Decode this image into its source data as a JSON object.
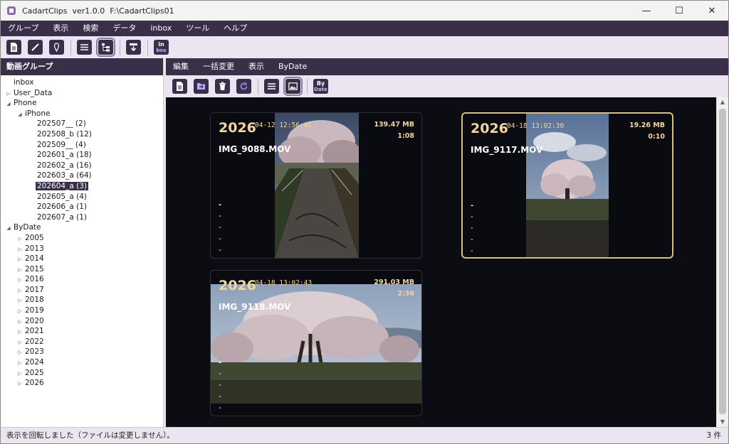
{
  "window": {
    "title": "CadartClips  ver1.0.0  F:\\CadartClips01",
    "minimize": "—",
    "maximize": "☐",
    "close": "✕"
  },
  "menu": [
    "グループ",
    "表示",
    "検索",
    "データ",
    "inbox",
    "ツール",
    "ヘルプ"
  ],
  "toolbar": {
    "inbox_label": "in",
    "inbox_sub": "box",
    "icons": [
      "document-icon",
      "pen-icon",
      "pin-icon",
      "list-icon",
      "tree-icon",
      "import-icon",
      "inbox-icon"
    ]
  },
  "left_panel": {
    "header": "動画グループ",
    "tree": [
      {
        "label": "inbox",
        "level": 0,
        "toggle": ""
      },
      {
        "label": "User_Data",
        "level": 0,
        "toggle": "▷"
      },
      {
        "label": "Phone",
        "level": 0,
        "toggle": "◢"
      },
      {
        "label": "iPhone",
        "level": 1,
        "toggle": "◢"
      },
      {
        "label": "202507__ (2)",
        "level": 2,
        "toggle": ""
      },
      {
        "label": "202508_b (12)",
        "level": 2,
        "toggle": ""
      },
      {
        "label": "202509__ (4)",
        "level": 2,
        "toggle": ""
      },
      {
        "label": "202601_a (18)",
        "level": 2,
        "toggle": ""
      },
      {
        "label": "202602_a (16)",
        "level": 2,
        "toggle": ""
      },
      {
        "label": "202603_a (64)",
        "level": 2,
        "toggle": ""
      },
      {
        "label": "202604_a (3)",
        "level": 2,
        "toggle": "",
        "selected": true
      },
      {
        "label": "202605_a (4)",
        "level": 2,
        "toggle": ""
      },
      {
        "label": "202606_a (1)",
        "level": 2,
        "toggle": ""
      },
      {
        "label": "202607_a (1)",
        "level": 2,
        "toggle": ""
      },
      {
        "label": "ByDate",
        "level": 0,
        "toggle": "◢"
      },
      {
        "label": "2005",
        "level": 1,
        "toggle": "▷"
      },
      {
        "label": "2013",
        "level": 1,
        "toggle": "▷"
      },
      {
        "label": "2014",
        "level": 1,
        "toggle": "▷"
      },
      {
        "label": "2015",
        "level": 1,
        "toggle": "▷"
      },
      {
        "label": "2016",
        "level": 1,
        "toggle": "▷"
      },
      {
        "label": "2017",
        "level": 1,
        "toggle": "▷"
      },
      {
        "label": "2018",
        "level": 1,
        "toggle": "▷"
      },
      {
        "label": "2019",
        "level": 1,
        "toggle": "▷"
      },
      {
        "label": "2020",
        "level": 1,
        "toggle": "▷"
      },
      {
        "label": "2021",
        "level": 1,
        "toggle": "▷"
      },
      {
        "label": "2022",
        "level": 1,
        "toggle": "▷"
      },
      {
        "label": "2023",
        "level": 1,
        "toggle": "▷"
      },
      {
        "label": "2024",
        "level": 1,
        "toggle": "▷"
      },
      {
        "label": "2025",
        "level": 1,
        "toggle": "▷"
      },
      {
        "label": "2026",
        "level": 1,
        "toggle": "▷"
      }
    ]
  },
  "right_panel": {
    "menu": [
      "編集",
      "一括変更",
      "表示",
      "ByDate"
    ],
    "toolbar": {
      "bydate_top": "By",
      "bydate_sub": "Date"
    },
    "cards": [
      {
        "year": "2026",
        "datetime": "04-12 12:56:41",
        "size": "139.47 MB",
        "duration": "1:08",
        "filename": "IMG_9088.MOV",
        "lines": [
          "-",
          "-",
          "-",
          "-",
          "-"
        ],
        "selected": false
      },
      {
        "year": "2026",
        "datetime": "04-18 13:02:30",
        "size": "19.26 MB",
        "duration": "0:10",
        "filename": "IMG_9117.MOV",
        "lines": [
          "-",
          "-",
          "-",
          "-",
          "-"
        ],
        "selected": true
      },
      {
        "year": "2026",
        "datetime": "04-18 13:02:43",
        "size": "291.03 MB",
        "duration": "2:36",
        "filename": "IMG_9118.MOV",
        "lines": [
          "-",
          "-",
          "-",
          "-",
          "-"
        ],
        "selected": false
      }
    ]
  },
  "status": {
    "message": "表示を回転しました（ファイルは変更しません）。",
    "count": "3 件"
  },
  "colors": {
    "accent_dark": "#3a2f48",
    "card_text": "#f2d59a",
    "selected_border": "#d9bf7e"
  }
}
